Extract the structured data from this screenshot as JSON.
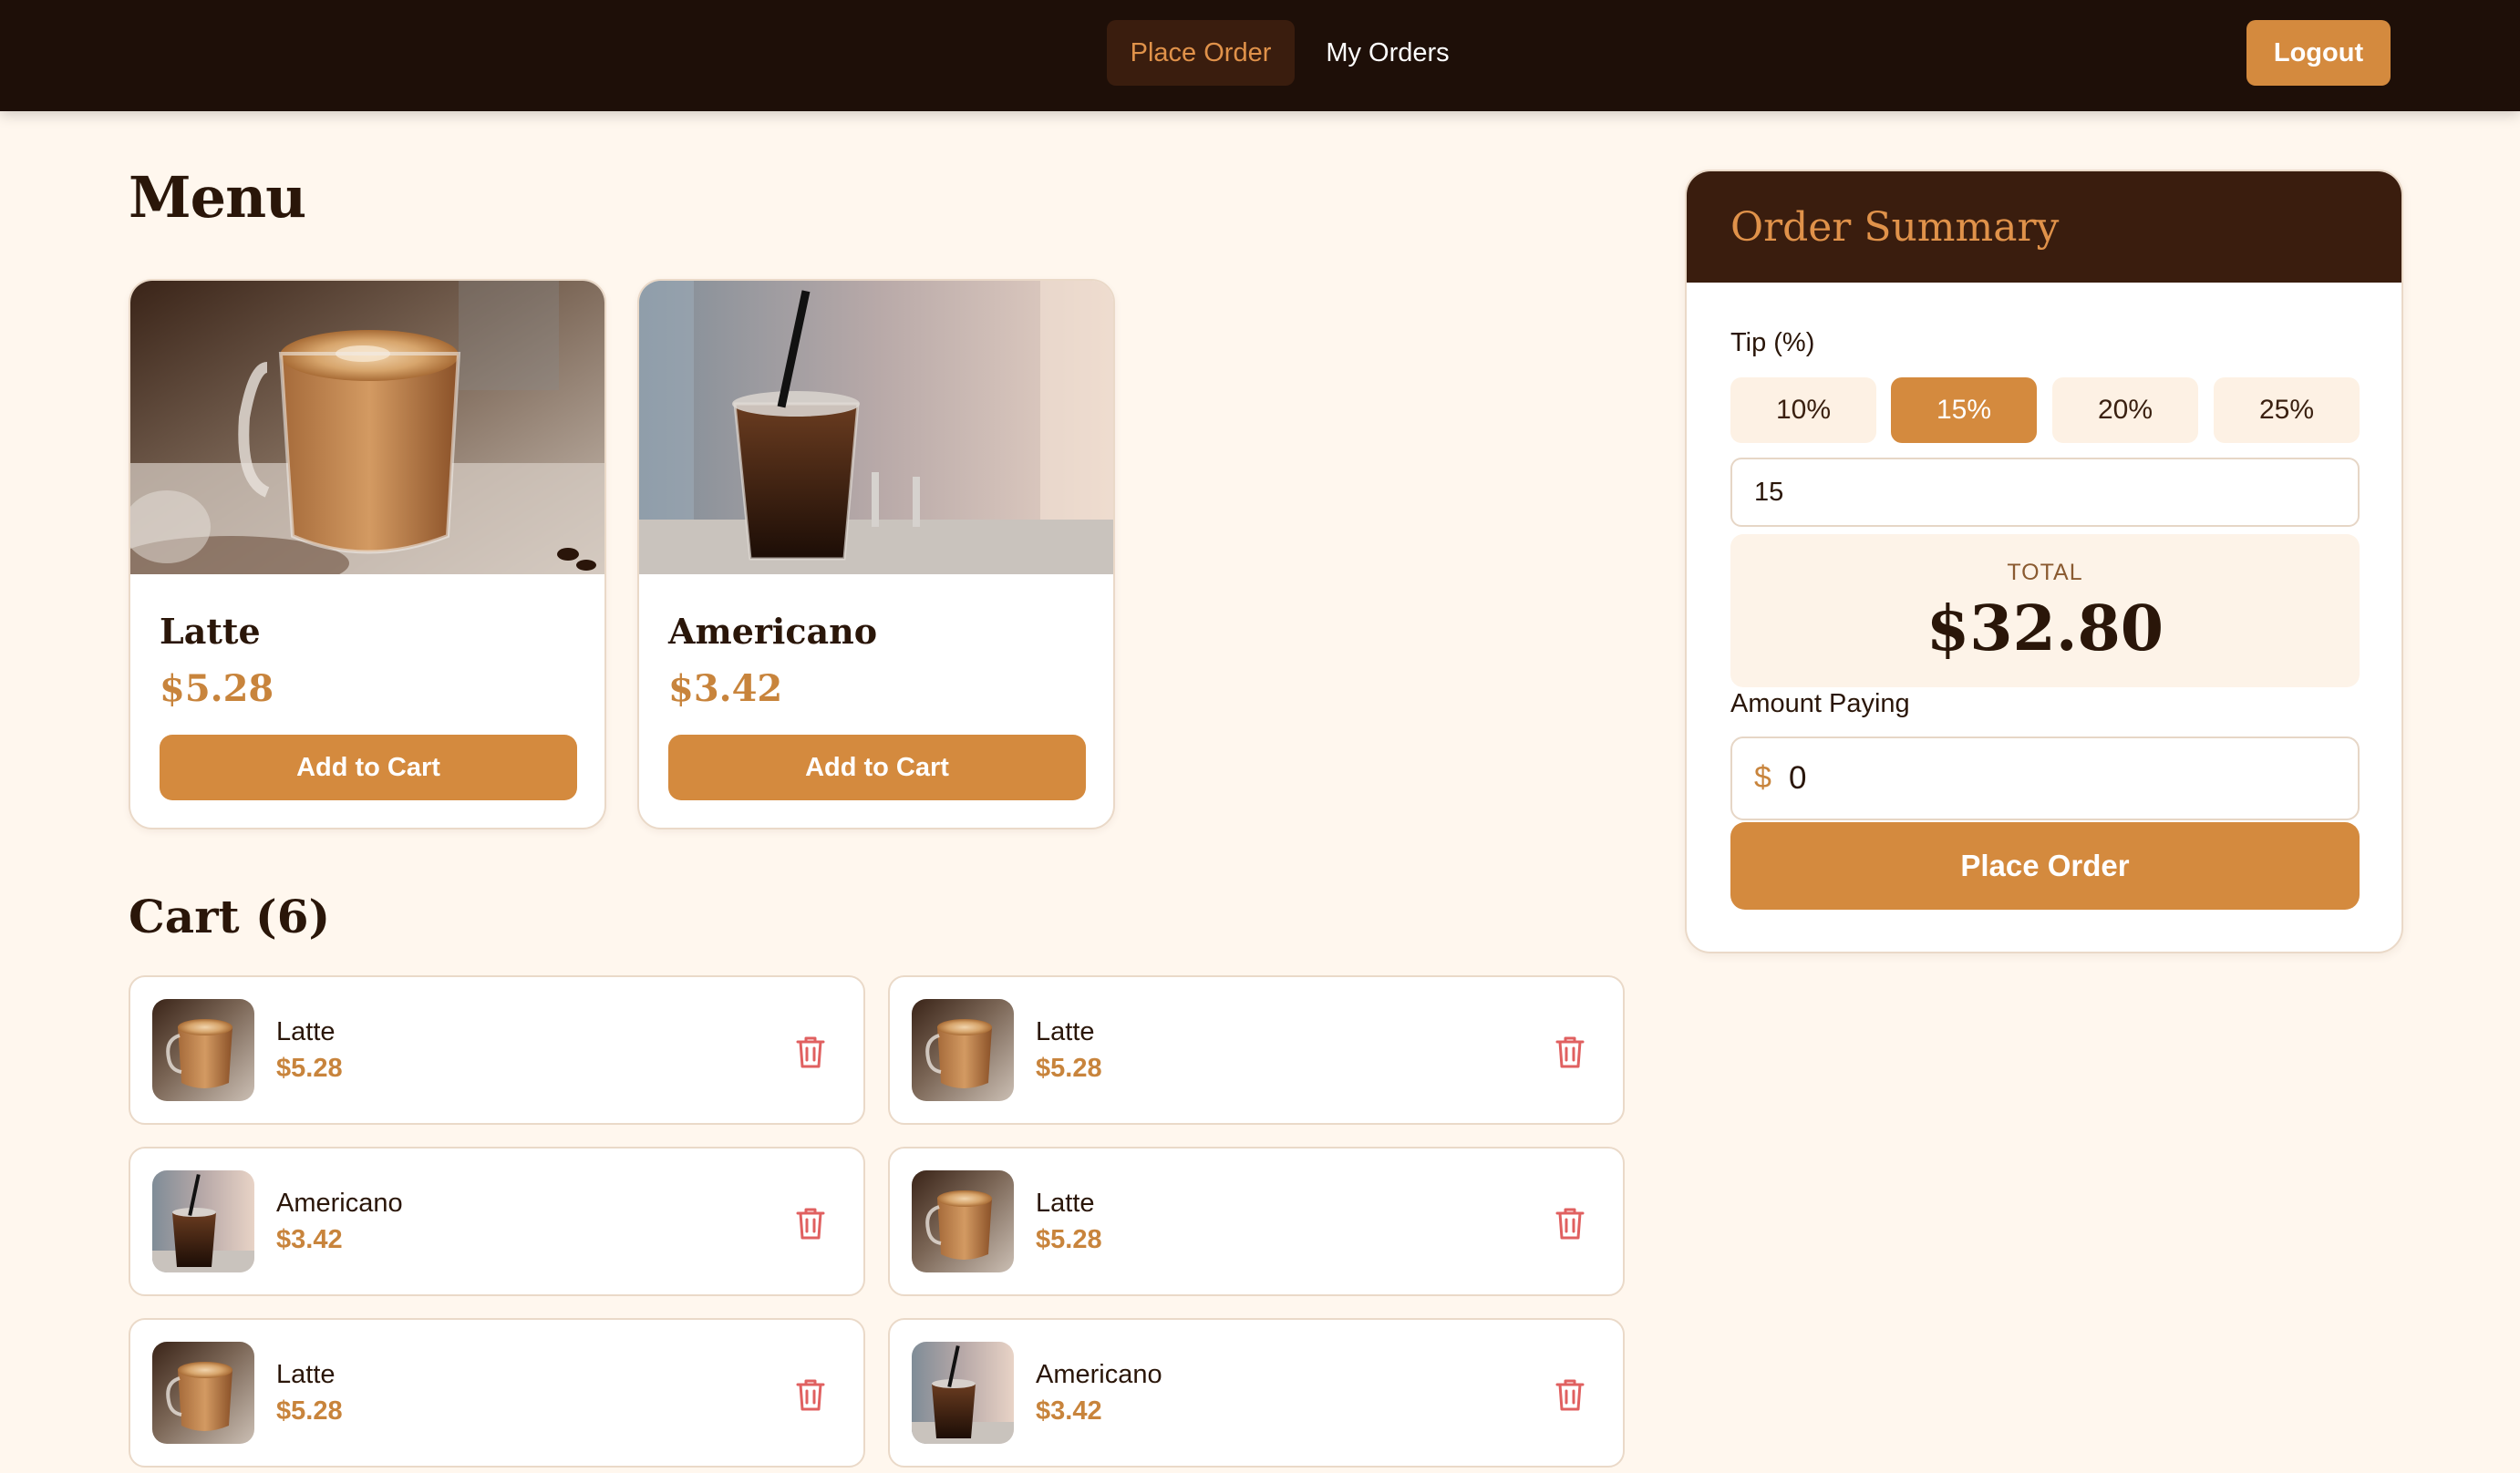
{
  "nav": {
    "place_order": "Place Order",
    "my_orders": "My Orders",
    "logout": "Logout"
  },
  "menu": {
    "heading": "Menu",
    "items": [
      {
        "name": "Latte",
        "price": "$5.28",
        "button": "Add to Cart",
        "image": "latte-photo"
      },
      {
        "name": "Americano",
        "price": "$3.42",
        "button": "Add to Cart",
        "image": "iced-americano-photo"
      }
    ]
  },
  "cart": {
    "heading": "Cart (6)",
    "items": [
      {
        "name": "Latte",
        "price": "$5.28",
        "icon": "trash-icon"
      },
      {
        "name": "Latte",
        "price": "$5.28",
        "icon": "trash-icon"
      },
      {
        "name": "Americano",
        "price": "$3.42",
        "icon": "trash-icon"
      },
      {
        "name": "Latte",
        "price": "$5.28",
        "icon": "trash-icon"
      },
      {
        "name": "Latte",
        "price": "$5.28",
        "icon": "trash-icon"
      },
      {
        "name": "Americano",
        "price": "$3.42",
        "icon": "trash-icon"
      }
    ]
  },
  "summary": {
    "title": "Order Summary",
    "tip_label": "Tip (%)",
    "tip_options": [
      "10%",
      "15%",
      "20%",
      "25%"
    ],
    "tip_selected": "15%",
    "tip_value": "15",
    "total_label": "TOTAL",
    "total_value": "$32.80",
    "paying_label": "Amount Paying",
    "currency_symbol": "$",
    "paying_value": "0",
    "place_order": "Place Order"
  },
  "colors": {
    "accent": "#d48a3e",
    "nav_bg": "#1e0f08",
    "summary_header": "#3a1d0e",
    "page_bg": "#fff7ee",
    "delete": "#e06060"
  }
}
